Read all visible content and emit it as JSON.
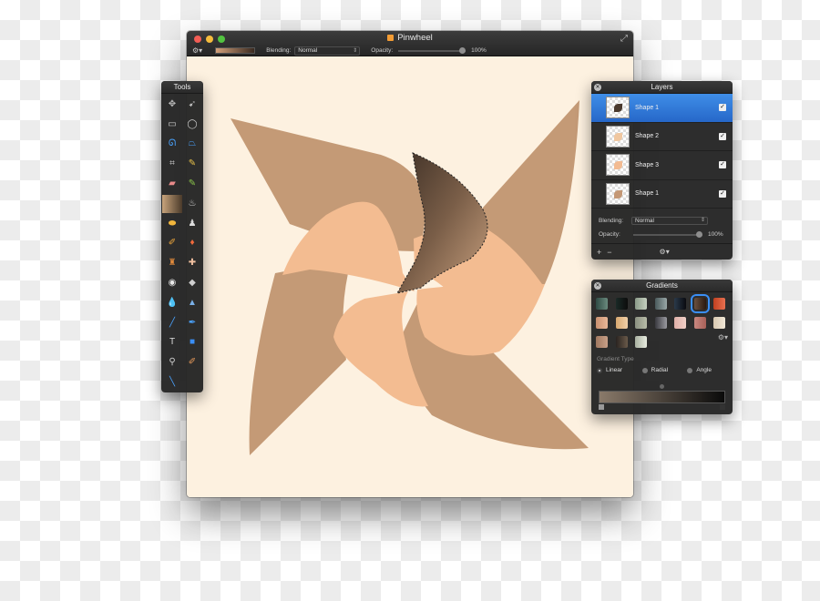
{
  "window": {
    "title": "Pinwheel",
    "blending_label": "Blending:",
    "blending_value": "Normal",
    "opacity_label": "Opacity:",
    "opacity_value": "100%"
  },
  "tools": {
    "title": "Tools",
    "items": [
      {
        "name": "move-tool-icon",
        "glyph": "✥",
        "color": "#bbbbbb"
      },
      {
        "name": "select-arrow-icon",
        "glyph": "➹",
        "color": "#bbbbbb"
      },
      {
        "name": "rect-select-icon",
        "glyph": "▭",
        "color": "#cfcfcf"
      },
      {
        "name": "ellipse-select-icon",
        "glyph": "◯",
        "color": "#cfcfcf"
      },
      {
        "name": "lasso-icon",
        "glyph": "ᘏ",
        "color": "#4aa3ff"
      },
      {
        "name": "polygon-lasso-icon",
        "glyph": "⏢",
        "color": "#4aa3ff"
      },
      {
        "name": "crop-icon",
        "glyph": "⌗",
        "color": "#cfcfcf"
      },
      {
        "name": "eyedropper-icon",
        "glyph": "✎",
        "color": "#e8c24a"
      },
      {
        "name": "eraser-icon",
        "glyph": "▰",
        "color": "#e88a8a"
      },
      {
        "name": "pencil-icon",
        "glyph": "✎",
        "color": "#8ac34a"
      },
      {
        "name": "gradient-swatch",
        "glyph": "",
        "color": "#cccccc"
      },
      {
        "name": "paint-bucket-icon",
        "glyph": "♨",
        "color": "#dddddd"
      },
      {
        "name": "sponge-icon",
        "glyph": "⬬",
        "color": "#f0b53c"
      },
      {
        "name": "stamp-icon",
        "glyph": "♟",
        "color": "#dddddd"
      },
      {
        "name": "brush-icon",
        "glyph": "✐",
        "color": "#f0a83c"
      },
      {
        "name": "burn-icon",
        "glyph": "♦",
        "color": "#f06a3c"
      },
      {
        "name": "clone-stamp-icon",
        "glyph": "♜",
        "color": "#e08a3c"
      },
      {
        "name": "heal-icon",
        "glyph": "✚",
        "color": "#f0c0a0"
      },
      {
        "name": "red-eye-icon",
        "glyph": "◉",
        "color": "#e8e8e8"
      },
      {
        "name": "smudge-icon",
        "glyph": "◆",
        "color": "#cfcfcf"
      },
      {
        "name": "blur-drop-icon",
        "glyph": "💧",
        "color": "#4aa3ff"
      },
      {
        "name": "sharpen-icon",
        "glyph": "▲",
        "color": "#7ab0e8"
      },
      {
        "name": "pen-line-icon",
        "glyph": "╱",
        "color": "#4aa3ff"
      },
      {
        "name": "pen-path-icon",
        "glyph": "✒",
        "color": "#4aa3ff"
      },
      {
        "name": "text-tool-icon",
        "glyph": "T",
        "color": "#dddddd"
      },
      {
        "name": "shape-tool-icon",
        "glyph": "■",
        "color": "#3a8ef5"
      },
      {
        "name": "zoom-icon",
        "glyph": "⚲",
        "color": "#cfcfcf"
      },
      {
        "name": "smudge-brush-icon",
        "glyph": "✐",
        "color": "#e89a5a"
      },
      {
        "name": "paint-brush-icon",
        "glyph": "╲",
        "color": "#4aa3ff"
      }
    ]
  },
  "layers": {
    "title": "Layers",
    "items": [
      {
        "name": "Shape 1",
        "thumb": "#4a3a2e",
        "selected": true
      },
      {
        "name": "Shape 2",
        "thumb": "#f0c7a0",
        "selected": false
      },
      {
        "name": "Shape 3",
        "thumb": "#f3bb92",
        "selected": false
      },
      {
        "name": "Shape 1",
        "thumb": "#c49876",
        "selected": false
      }
    ],
    "blending_label": "Blending:",
    "blending_value": "Normal",
    "opacity_label": "Opacity:",
    "opacity_value": "100%",
    "add_glyph": "+",
    "remove_glyph": "−",
    "gear_glyph": "⚙"
  },
  "gradients": {
    "title": "Gradients",
    "swatches": [
      "linear-gradient(90deg,#2f4b44,#6a8a7e)",
      "linear-gradient(90deg,#1a2a26,#0c0c0c)",
      "linear-gradient(90deg,#8a9a88,#c6d0c0)",
      "linear-gradient(90deg,#4a5a5c,#9aa8a8)",
      "linear-gradient(90deg,#2a3a4a,#0a0a10)",
      "linear-gradient(90deg,#6a5040,#2a1a10)",
      "linear-gradient(90deg,#c04020,#e87050)",
      "linear-gradient(90deg,#c89070,#e8b898)",
      "linear-gradient(90deg,#d8a870,#f0d0a8)",
      "linear-gradient(90deg,#8a9080,#b8bca8)",
      "linear-gradient(90deg,#3a3a40,#9a9aa0)",
      "linear-gradient(90deg,#e0b0a8,#f0d0c8)",
      "linear-gradient(90deg,#c88880,#a86058)",
      "linear-gradient(90deg,#d8c8b0,#f0e8d8)",
      "linear-gradient(90deg,#a07860,#c8a088)",
      "linear-gradient(90deg,#2a2420,#6a5a4a)",
      "linear-gradient(90deg,#a8b0a0,#e8ece0)"
    ],
    "selected_index": 5,
    "gradient_type_label": "Gradient Type",
    "types": [
      "Linear",
      "Radial",
      "Angle"
    ],
    "selected_type": "Linear"
  },
  "colors": {
    "canvas": "#fdf1e0",
    "blade_dark": "#c49a76",
    "blade_light": "#f3bc91",
    "selection_highlight": "#3a8ef5"
  }
}
